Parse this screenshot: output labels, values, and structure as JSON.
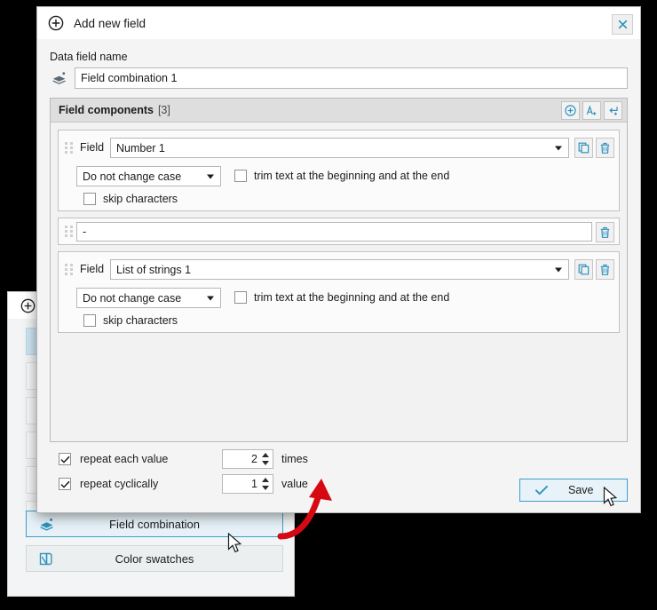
{
  "dialog": {
    "title": "Add new field",
    "title_icon": "plus-circle-icon",
    "close_icon": "close-icon",
    "data_field_label": "Data field name",
    "data_field_icon": "layers-icon",
    "data_field_value": "Field combination 1",
    "data_field_placeholder": "Field combination 1"
  },
  "components": {
    "header_title": "Field components",
    "header_count": "[3]",
    "header_buttons": [
      {
        "name": "add-component-button",
        "icon": "plus-circle-icon"
      },
      {
        "name": "add-text-button",
        "icon": "a-plus-icon"
      },
      {
        "name": "add-newline-button",
        "icon": "return-plus-icon"
      }
    ],
    "items": [
      {
        "type": "field",
        "label": "Field",
        "field_value": "Number 1",
        "case_value": "Do not change case",
        "trim_label": "trim text at the beginning and at the end",
        "trim_checked": false,
        "skip_label": "skip characters",
        "skip_checked": false,
        "copy_icon": "copy-icon",
        "delete_icon": "trash-icon"
      },
      {
        "type": "text",
        "text_value": "-",
        "text_placeholder": "-",
        "delete_icon": "trash-icon"
      },
      {
        "type": "field",
        "label": "Field",
        "field_value": "List of strings 1",
        "case_value": "Do not change case",
        "trim_label": "trim text at the beginning and at the end",
        "trim_checked": false,
        "skip_label": "skip characters",
        "skip_checked": false,
        "copy_icon": "copy-icon",
        "delete_icon": "trash-icon"
      }
    ]
  },
  "repeat": {
    "each_value_label": "repeat each value",
    "each_value_checked": true,
    "each_value_count": "2",
    "each_value_unit": "times",
    "cyclically_label": "repeat cyclically",
    "cyclically_checked": true,
    "cyclically_count": "1",
    "cyclically_unit": "value"
  },
  "save": {
    "label": "Save",
    "icon": "check-icon"
  },
  "background_window": {
    "title_icon": "plus-circle-icon",
    "buttons": [
      {
        "label": "Field combination",
        "icon": "layers-icon",
        "active": true
      },
      {
        "label": "Color swatches",
        "icon": "swatches-icon",
        "active": false
      }
    ]
  },
  "annotation": {
    "arrow": "red-curved-arrow",
    "color": "#d60812"
  },
  "colors": {
    "accent": "#3b9ec8",
    "dialog_bg": "#f4f4f4",
    "panel_header": "#dedede",
    "selection": "#cfe7f3"
  }
}
